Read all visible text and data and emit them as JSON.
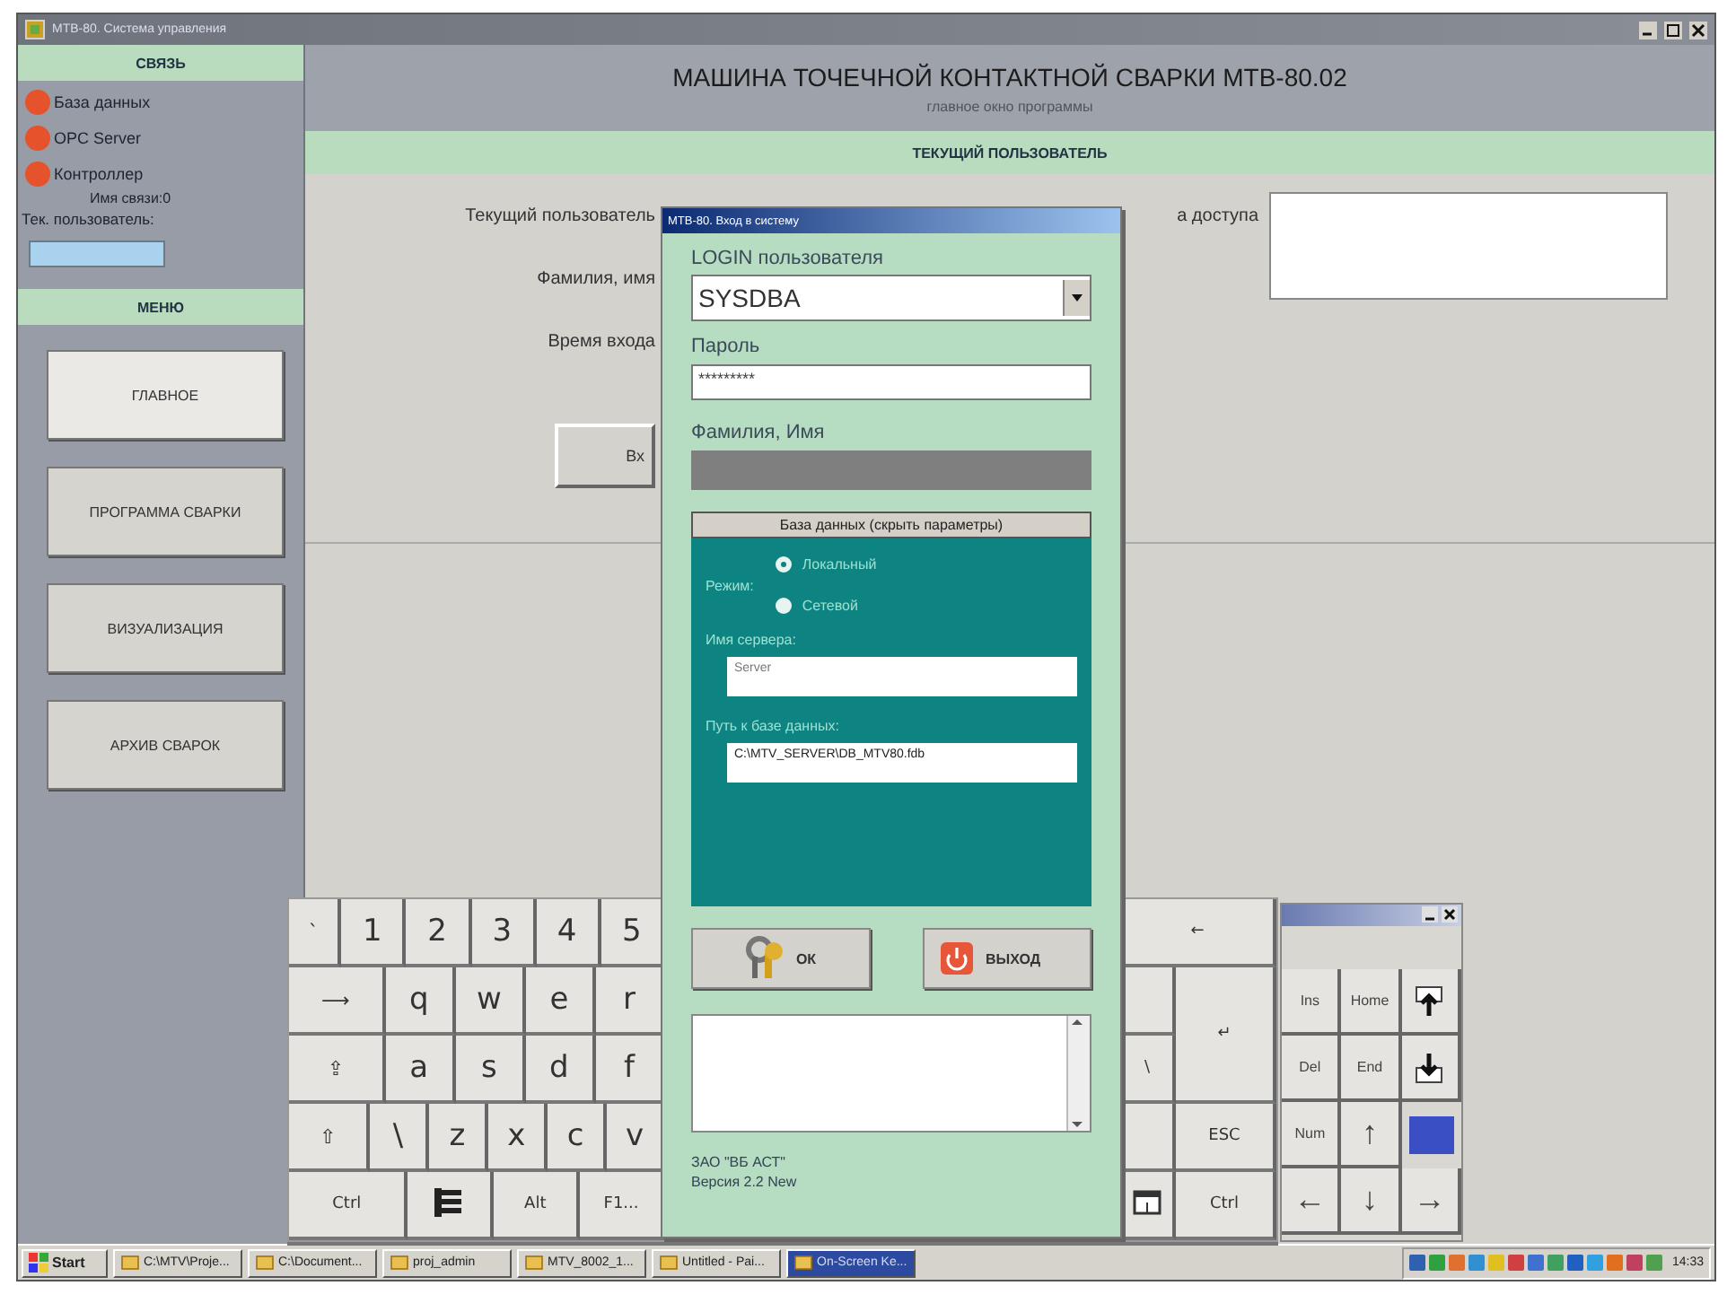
{
  "window": {
    "title": "МТВ-80. Система управления"
  },
  "sidebar": {
    "connection_header": "СВЯЗЬ",
    "connections": [
      {
        "label": "База данных",
        "connected": false
      },
      {
        "label": "OPC Server",
        "connected": false
      },
      {
        "label": "Контроллер",
        "connected": false,
        "note": "Имя связи:0"
      }
    ],
    "user_label": "Тек. пользователь:",
    "menu_header": "МЕНЮ",
    "menu": [
      {
        "label": "ГЛАВНОЕ",
        "selected": true
      },
      {
        "label": "ПРОГРАММА СВАРКИ",
        "selected": false
      },
      {
        "label": "ВИЗУАЛИЗАЦИЯ",
        "selected": false
      },
      {
        "label": "АРХИВ СВАРОК",
        "selected": false
      }
    ]
  },
  "header": {
    "title": "МАШИНА ТОЧЕЧНОЙ КОНТАКТНОЙ СВАРКИ МТВ-80.02",
    "subtitle": "главное окно программы"
  },
  "section_title": "ТЕКУЩИЙ ПОЛЬЗОВАТЕЛЬ",
  "user_panel": {
    "labels": [
      "Текущий пользователь",
      "Фамилия, имя",
      "Время входа"
    ],
    "access_label": "а доступа",
    "button": "Вх"
  },
  "login_dialog": {
    "title": "МТВ-80. Вход в систему",
    "login_label": "LOGIN пользователя",
    "login_value": "SYSDBA",
    "password_label": "Пароль",
    "password_value": "*********",
    "name_label": "Фамилия, Имя",
    "db_button": "База данных (скрыть параметры)",
    "mode_label": "Режим:",
    "modes": [
      {
        "label": "Локальный",
        "selected": true
      },
      {
        "label": "Сетевой",
        "selected": false
      }
    ],
    "server_label": "Имя сервера:",
    "server_value": "Server",
    "path_label": "Путь к базе данных:",
    "path_value": "C:\\MTV_SERVER\\DB_MTV80.fdb",
    "ok_button": "ОК",
    "exit_button": "ВЫХОД",
    "company": "ЗАО \"ВБ АСТ\"",
    "version": "Версия 2.2 New"
  },
  "keyboard": {
    "left_rows": [
      [
        "`",
        "1",
        "2",
        "3",
        "4",
        "5"
      ],
      [
        "⟶",
        "q",
        "w",
        "e",
        "r"
      ],
      [
        "⇪",
        "a",
        "s",
        "d",
        "f"
      ],
      [
        "⇧",
        "\\",
        "z",
        "x",
        "c",
        "v"
      ],
      [
        "Ctrl",
        {
          "kind": "menu"
        },
        "Alt",
        "F1..."
      ]
    ],
    "right_keys": [
      {
        "kind": "backspace",
        "label": "←"
      },
      {
        "kind": "blank"
      },
      {
        "kind": "enter",
        "label": "↵"
      },
      {
        "kind": "char",
        "label": "\\"
      },
      {
        "kind": "blank"
      },
      {
        "kind": "char",
        "label": "ESC"
      },
      {
        "kind": "window"
      },
      {
        "kind": "char",
        "label": "Ctrl"
      }
    ]
  },
  "keypad": {
    "keys": [
      {
        "kind": "char",
        "label": "Ins"
      },
      {
        "kind": "char",
        "label": "Home"
      },
      {
        "kind": "pageup"
      },
      {
        "kind": "char",
        "label": "Del"
      },
      {
        "kind": "char",
        "label": "End"
      },
      {
        "kind": "pagedown"
      },
      {
        "kind": "char",
        "label": "Num"
      },
      {
        "kind": "char",
        "label": "↑"
      },
      {
        "kind": "blank",
        "active": true
      },
      {
        "kind": "char",
        "label": "←"
      },
      {
        "kind": "char",
        "label": "↓"
      },
      {
        "kind": "char",
        "label": "→"
      }
    ]
  },
  "taskbar": {
    "start": "Start",
    "tasks": [
      {
        "label": "C:\\MTV\\Proje...",
        "selected": false
      },
      {
        "label": "C:\\Document...",
        "selected": false
      },
      {
        "label": "proj_admin",
        "selected": false
      },
      {
        "label": "MTV_8002_1...",
        "selected": false
      },
      {
        "label": "Untitled - Pai...",
        "selected": false
      },
      {
        "label": "On-Screen Ke...",
        "selected": true
      }
    ],
    "clock": "14:33"
  }
}
